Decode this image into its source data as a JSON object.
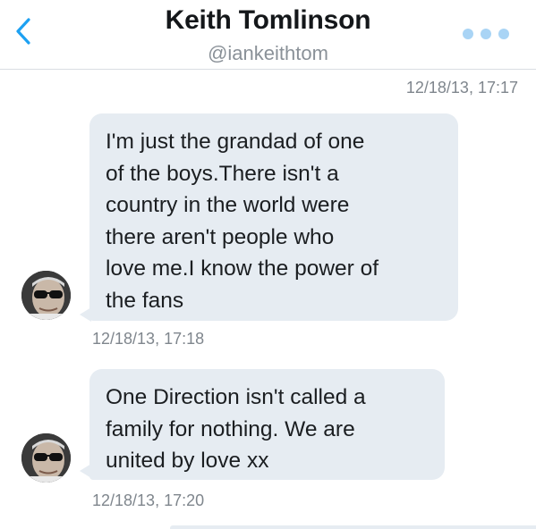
{
  "header": {
    "title": "Keith Tomlinson",
    "handle": "@iankeithtom",
    "back_icon": "chevron-left-icon",
    "more_icon": "more-dots-icon",
    "accent_color": "#1da1f2"
  },
  "conversation": {
    "top_timestamp": "12/18/13, 17:17",
    "messages": [
      {
        "lines": [
          "I'm just the grandad of one",
          "of the boys.There isn't a",
          "country in the world were",
          "there aren't people who",
          "love me.I know the power of",
          "the fans"
        ],
        "timestamp": "12/18/13, 17:18"
      },
      {
        "lines": [
          "One Direction isn't called a",
          "family for nothing. We are",
          "united  by love xx"
        ],
        "timestamp": "12/18/13, 17:20"
      }
    ],
    "bubble_color": "#e6ecf2"
  }
}
